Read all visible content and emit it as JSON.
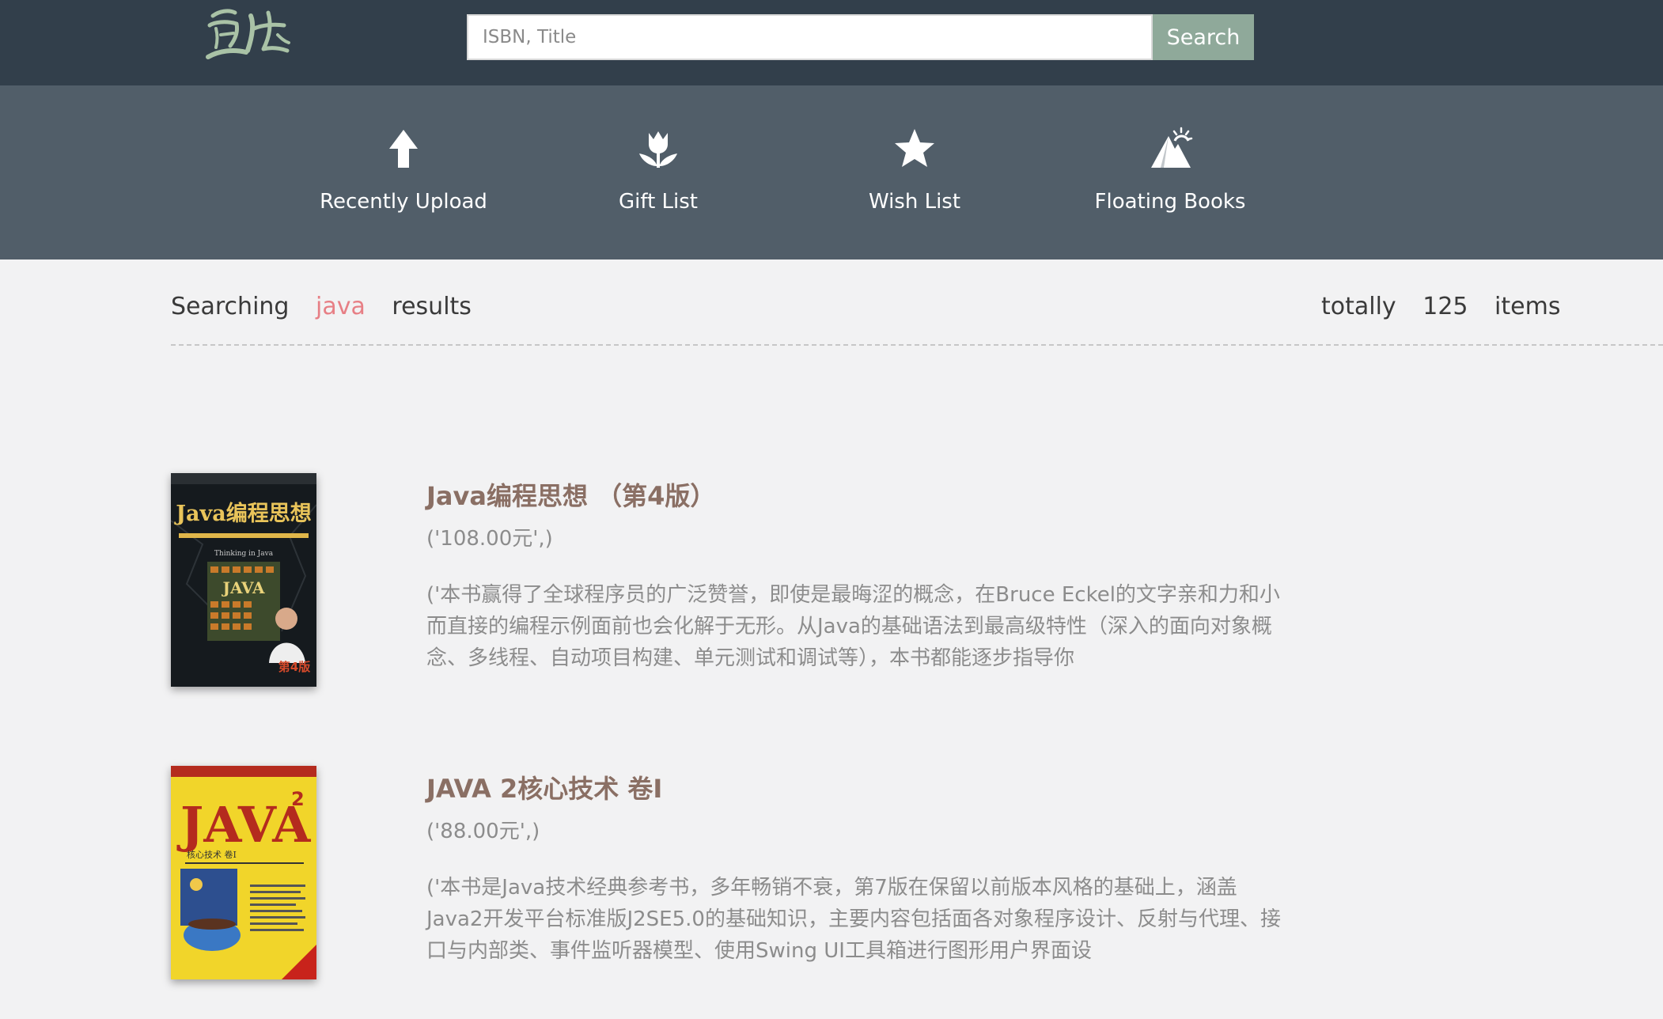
{
  "search": {
    "placeholder": "ISBN, Title",
    "value": "",
    "button_label": "Search"
  },
  "nav": {
    "items": [
      {
        "label": "Recently Upload",
        "icon": "upload-arrow-icon"
      },
      {
        "label": "Gift List",
        "icon": "tulip-icon"
      },
      {
        "label": "Wish List",
        "icon": "star-icon"
      },
      {
        "label": "Floating Books",
        "icon": "mountain-sun-icon"
      }
    ]
  },
  "results": {
    "prefix": "Searching",
    "keyword": "java",
    "suffix": "results",
    "total_prefix": "totally",
    "total": "125",
    "total_suffix": "items"
  },
  "books": [
    {
      "title": "Java编程思想 （第4版）",
      "price": "('108.00元',)",
      "summary": "('本书赢得了全球程序员的广泛赞誉，即使是最晦涩的概念，在Bruce Eckel的文字亲和力和小而直接的编程示例面前也会化解于无形。从Java的基础语法到最高级特性（深入的面向对象概念、多线程、自动项目构建、单元测试和调试等），本书都能逐步指导你",
      "cover": {
        "title": "Java编程思想",
        "subtitle": "Thinking in Java",
        "edition": "第4版",
        "colors": {
          "bg": "#151a1e",
          "title": "#e9c45a",
          "accent": "#d44a2b"
        }
      }
    },
    {
      "title": "JAVA 2核心技术 卷I",
      "price": "('88.00元',)",
      "summary": "('本书是Java技术经典参考书，多年畅销不衰，第7版在保留以前版本风格的基础上，涵盖Java2开发平台标准版J2SE5.0的基础知识，主要内容包括面各对象程序设计、反射与代理、接口与内部类、事件监听器模型、使用Swing UI工具箱进行图形用户界面设",
      "cover": {
        "title": "JAVA",
        "superscript": "2",
        "subtitle": "核心技术 卷I",
        "colors": {
          "bg": "#f1d52a",
          "title": "#b42b1e",
          "band": "#c8231b"
        }
      }
    }
  ],
  "colors": {
    "topbar": "#323f4b",
    "navbar": "#515e69",
    "search_button": "#8fa99a",
    "keyword": "#e77f85",
    "book_title": "#8a6f64"
  }
}
